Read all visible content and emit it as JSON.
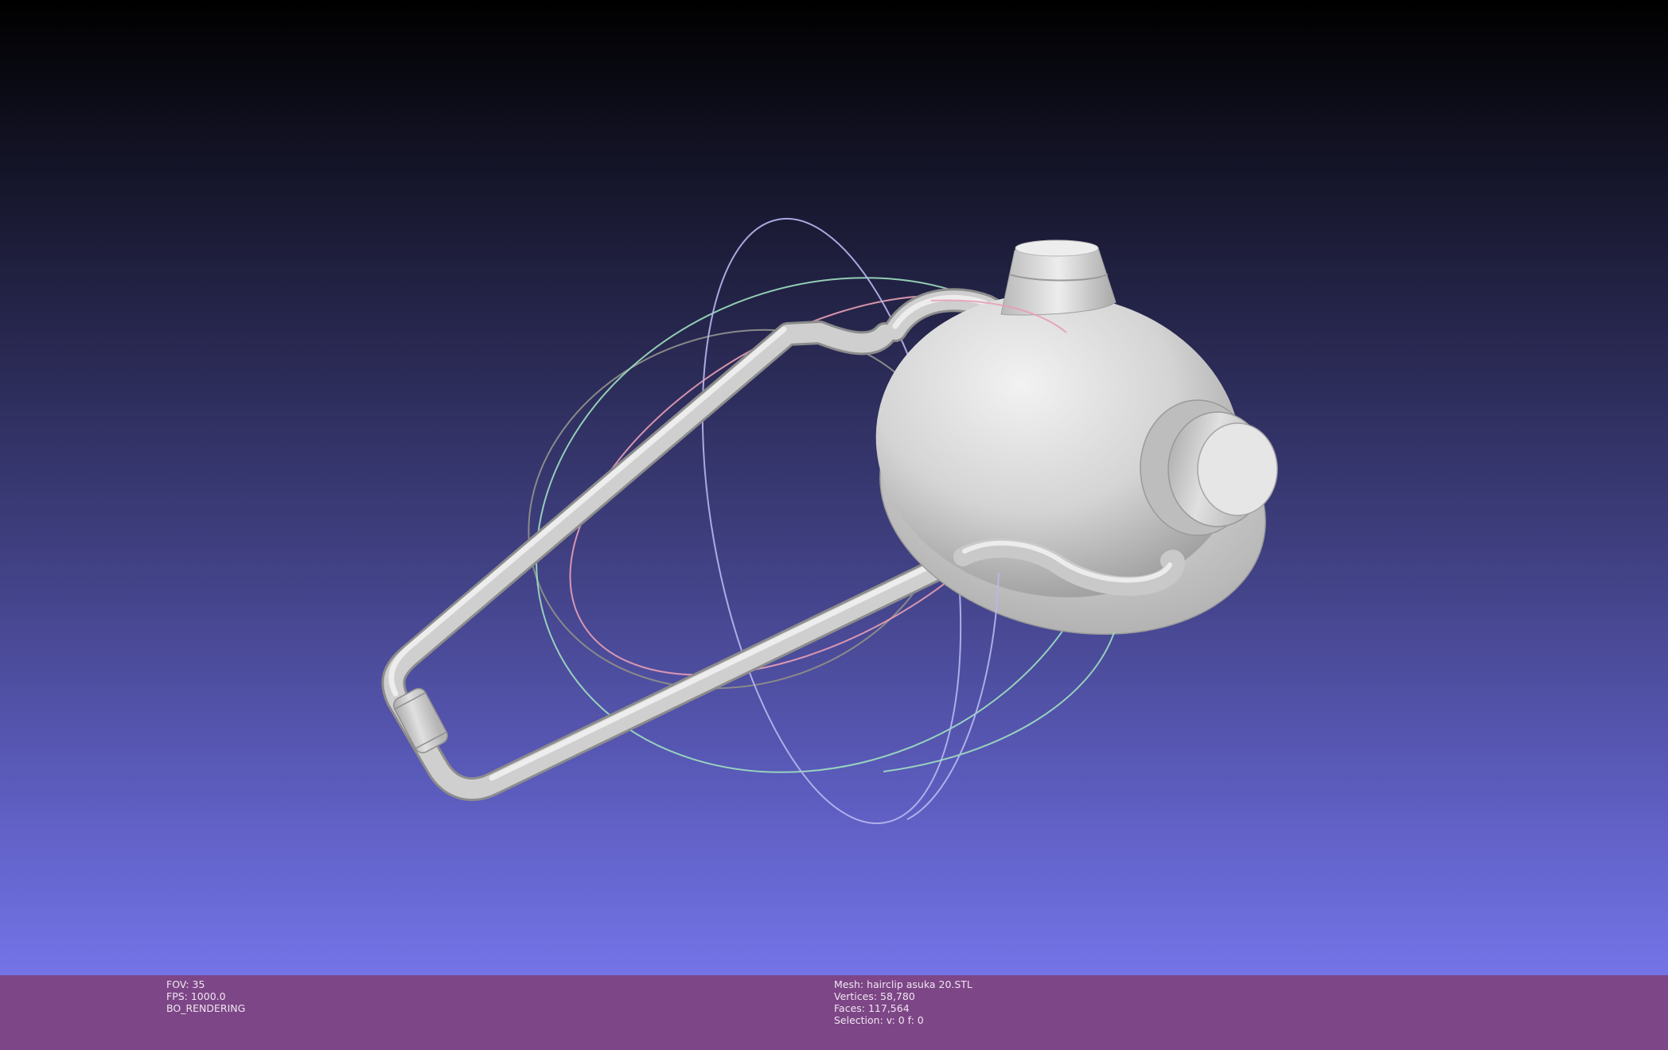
{
  "app": {
    "theme": {
      "background_top": "#000000",
      "background_bottom": "#7474e8",
      "status_bar_color": "#7d4686",
      "mesh_color": "#d9d9d9",
      "trackball_colors": {
        "x_ring": "#e8a0b4",
        "y_ring": "#9fe0c0",
        "z_ring": "#b8b8f0",
        "outer_ring": "#8a8a8a"
      }
    }
  },
  "render_info": {
    "fov": "FOV: 35",
    "fps": "FPS:  1000.0",
    "mode": "BO_RENDERING"
  },
  "mesh_info": {
    "mesh": "Mesh: hairclip asuka 20.STL",
    "vertices": "Vertices: 58,780",
    "faces": "Faces: 117,564",
    "selection": "Selection: v: 0 f: 0"
  }
}
